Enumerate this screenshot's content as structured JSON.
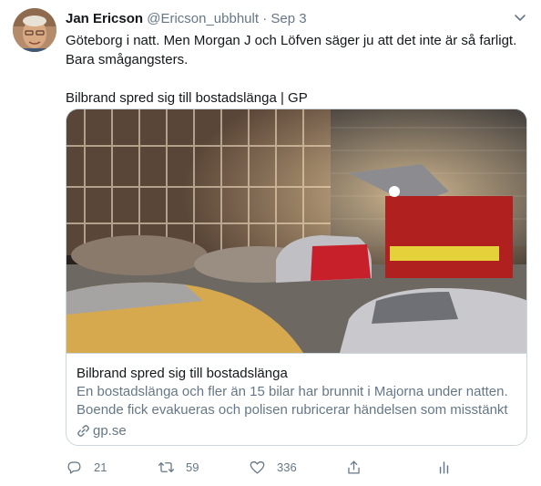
{
  "tweet": {
    "author_name": "Jan Ericson",
    "author_handle": "@Ericson_ubbhult",
    "separator": "·",
    "date": "Sep 3",
    "text_lines": [
      "Göteborg i natt. Men Morgan J och Löfven säger ju att det inte är så farligt.",
      "Bara smågangsters.",
      "Bilbrand spred sig till bostadslänga | GP"
    ]
  },
  "card": {
    "title": "Bilbrand spred sig till bostadslänga",
    "description": "En bostadslänga och fler än 15 bilar har brunnit i Majorna under natten. Boende fick evakueras och polisen rubricerar händelsen som misstänkt ...",
    "domain": "gp.se"
  },
  "actions": {
    "reply_count": "21",
    "retweet_count": "59",
    "like_count": "336"
  },
  "icons": {
    "caret": "chevron-down-icon",
    "reply": "reply-icon",
    "retweet": "retweet-icon",
    "like": "heart-icon",
    "share": "share-icon",
    "analytics": "analytics-icon",
    "link": "link-icon"
  },
  "colors": {
    "text": "#14171a",
    "secondary": "#657786",
    "border": "#ccd6dd"
  }
}
